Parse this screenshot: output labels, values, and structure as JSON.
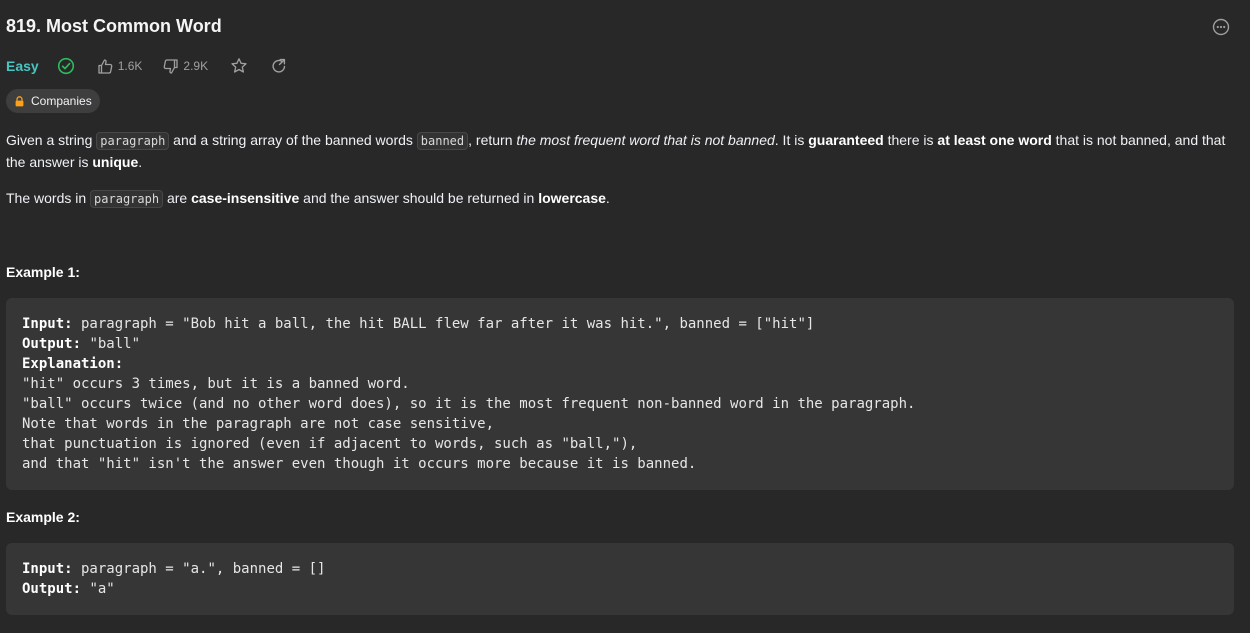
{
  "problem": {
    "title": "819. Most Common Word",
    "difficulty": "Easy",
    "likes": "1.6K",
    "dislikes": "2.9K",
    "companies_label": "Companies"
  },
  "colors": {
    "background": "#282828",
    "difficulty_easy": "#46c6c2",
    "solved_check": "#2cbb5d",
    "code_box": "#363636"
  },
  "icons": {
    "more": "more-options-icon",
    "solved": "check-circle-icon",
    "like": "thumbs-up-icon",
    "dislike": "thumbs-down-icon",
    "star": "star-icon",
    "share": "share-icon",
    "lock": "lock-icon"
  },
  "description": {
    "p1": {
      "t1": "Given a string ",
      "c1": "paragraph",
      "t2": " and a string array of the banned words ",
      "c2": "banned",
      "t3": ", return ",
      "i1": "the most frequent word that is not banned",
      "t4": ". It is ",
      "b1": "guaranteed",
      "t5": " there is ",
      "b2": "at least one word",
      "t6": " that is not banned, and that the answer is ",
      "b3": "unique",
      "t7": "."
    },
    "p2": {
      "t1": "The words in ",
      "c1": "paragraph",
      "t2": " are ",
      "b1": "case-insensitive",
      "t3": " and the answer should be returned in ",
      "b2": "lowercase",
      "t4": "."
    }
  },
  "examples": [
    {
      "heading": "Example 1:",
      "input_label": "Input:",
      "input": " paragraph = \"Bob hit a ball, the hit BALL flew far after it was hit.\", banned = [\"hit\"]",
      "output_label": "Output:",
      "output": " \"ball\"",
      "explanation_label": "Explanation:",
      "explanation": [
        "\"hit\" occurs 3 times, but it is a banned word.",
        "\"ball\" occurs twice (and no other word does), so it is the most frequent non-banned word in the paragraph.",
        "Note that words in the paragraph are not case sensitive,",
        "that punctuation is ignored (even if adjacent to words, such as \"ball,\"),",
        "and that \"hit\" isn't the answer even though it occurs more because it is banned."
      ]
    },
    {
      "heading": "Example 2:",
      "input_label": "Input:",
      "input": " paragraph = \"a.\", banned = []",
      "output_label": "Output:",
      "output": " \"a\""
    }
  ]
}
